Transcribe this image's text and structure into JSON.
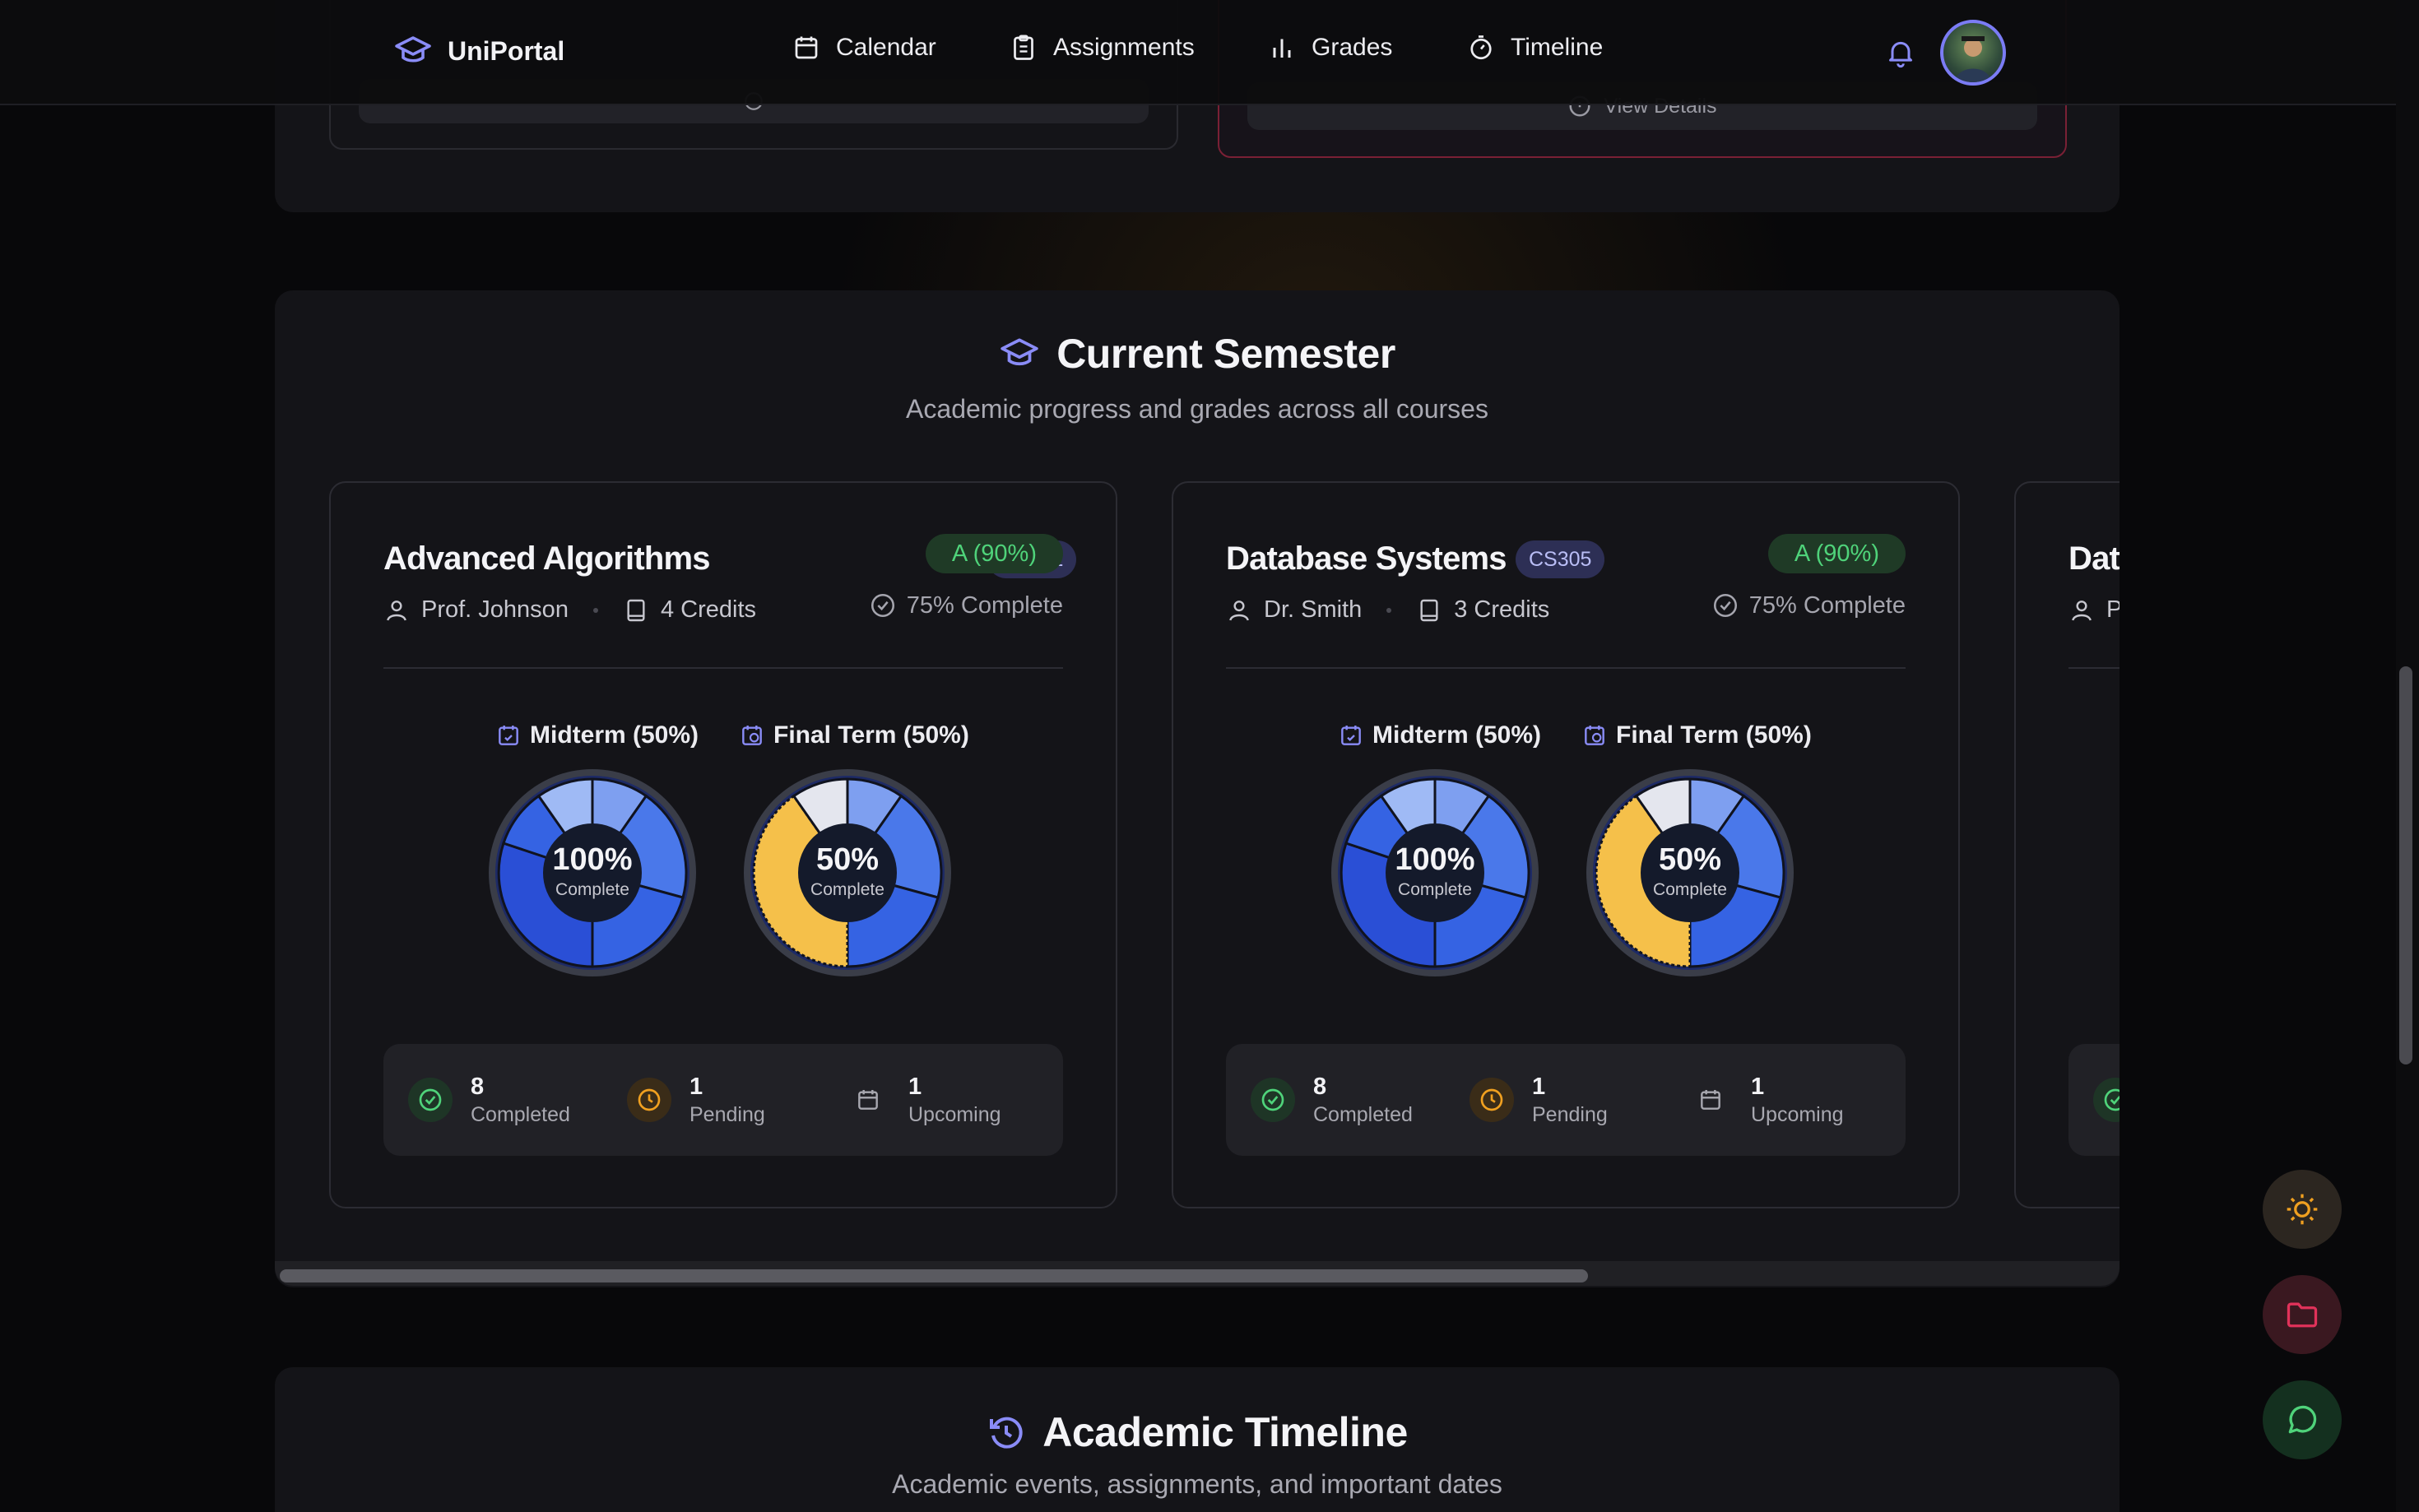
{
  "app": {
    "name": "UniPortal"
  },
  "nav": {
    "calendar": "Calendar",
    "assignments": "Assignments",
    "grades": "Grades",
    "timeline": "Timeline"
  },
  "previous": {
    "view_details": "View Details"
  },
  "semester": {
    "title": "Current Semester",
    "subtitle": "Academic progress and grades across all courses",
    "courses": [
      {
        "name": "Advanced Algorithms",
        "code": "CS301",
        "grade": "A (90%)",
        "instructor": "Prof. Johnson",
        "credits": "4 Credits",
        "progress": "75% Complete",
        "midterm": {
          "label": "Midterm (50%)",
          "percent": "100%",
          "sub": "Complete"
        },
        "final": {
          "label": "Final Term (50%)",
          "percent": "50%",
          "sub": "Complete"
        },
        "stats": {
          "completed": "8",
          "completed_label": "Completed",
          "pending": "1",
          "pending_label": "Pending",
          "upcoming": "1",
          "upcoming_label": "Upcoming"
        }
      },
      {
        "name": "Database Systems",
        "code": "CS305",
        "grade": "A (90%)",
        "instructor": "Dr. Smith",
        "credits": "3 Credits",
        "progress": "75% Complete",
        "midterm": {
          "label": "Midterm (50%)",
          "percent": "100%",
          "sub": "Complete"
        },
        "final": {
          "label": "Final Term (50%)",
          "percent": "50%",
          "sub": "Complete"
        },
        "stats": {
          "completed": "8",
          "completed_label": "Completed",
          "pending": "1",
          "pending_label": "Pending",
          "upcoming": "1",
          "upcoming_label": "Upcoming"
        }
      },
      {
        "name_partial": "Dat",
        "instructor_partial": "P"
      }
    ]
  },
  "timeline": {
    "title": "Academic Timeline",
    "subtitle": "Academic events, assignments, and important dates"
  },
  "colors": {
    "accent": "#7b7cf5",
    "success": "#4fd37a",
    "warning": "#f0a020",
    "danger": "#e0325a",
    "donut_blue": "#3a5fe0",
    "donut_yellow": "#f5c04a"
  }
}
